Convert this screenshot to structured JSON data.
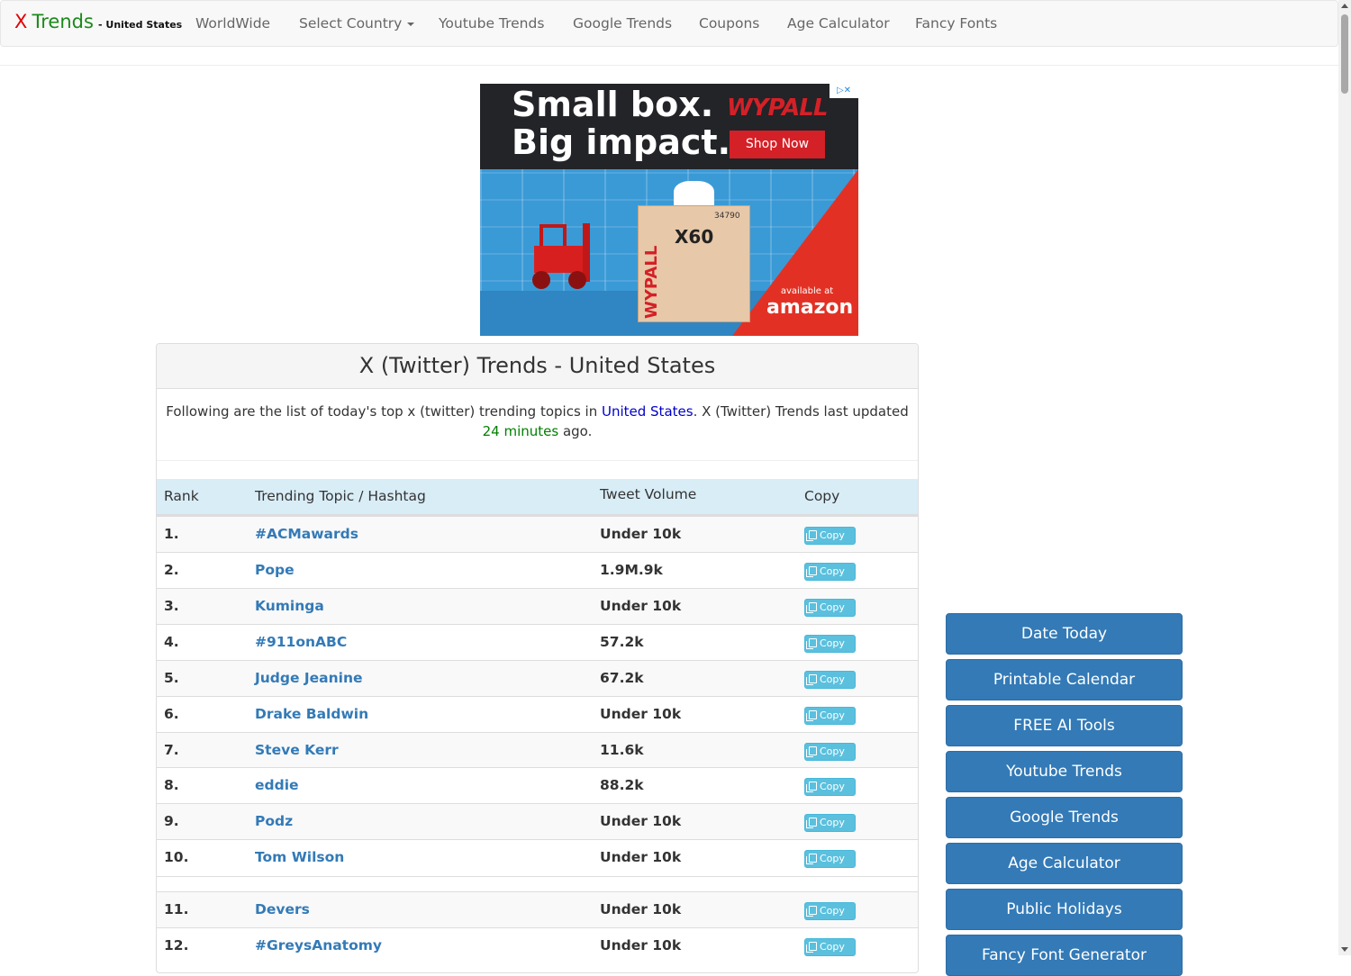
{
  "navbar": {
    "brand_x": "X",
    "brand_trends": "Trends",
    "brand_country": "- United States",
    "items": [
      {
        "label": "WorldWide"
      },
      {
        "label": "Select Country"
      },
      {
        "label": "Youtube Trends"
      },
      {
        "label": "Google Trends"
      },
      {
        "label": "Coupons"
      },
      {
        "label": "Age Calculator"
      },
      {
        "label": "Fancy Fonts"
      }
    ]
  },
  "ad": {
    "headline_1": "Small box.",
    "headline_2": "Big impact.",
    "brand": "WYPALL",
    "cta": "Shop Now",
    "product_label": "X60",
    "product_code": "34790",
    "available_at": "available at",
    "retailer": "amazon"
  },
  "panel": {
    "title": "X (Twitter) Trends - United States",
    "desc_prefix": "Following are the list of today's top x (twitter) trending topics in ",
    "desc_country": "United States",
    "desc_middle": ". X (Twitter) Trends last updated ",
    "desc_time": "24 minutes",
    "desc_suffix": " ago."
  },
  "table": {
    "headers": {
      "rank": "Rank",
      "topic": "Trending Topic / Hashtag",
      "volume": "Tweet Volume",
      "copy": "Copy"
    },
    "copy_label": "Copy",
    "rows": [
      {
        "rank": "1.",
        "topic": "#ACMawards",
        "volume": "Under 10k"
      },
      {
        "rank": "2.",
        "topic": "Pope",
        "volume": "1.9M.9k"
      },
      {
        "rank": "3.",
        "topic": "Kuminga",
        "volume": "Under 10k"
      },
      {
        "rank": "4.",
        "topic": "#911onABC",
        "volume": "57.2k"
      },
      {
        "rank": "5.",
        "topic": "Judge Jeanine",
        "volume": "67.2k"
      },
      {
        "rank": "6.",
        "topic": "Drake Baldwin",
        "volume": "Under 10k"
      },
      {
        "rank": "7.",
        "topic": "Steve Kerr",
        "volume": "11.6k"
      },
      {
        "rank": "8.",
        "topic": "eddie",
        "volume": "88.2k"
      },
      {
        "rank": "9.",
        "topic": "Podz",
        "volume": "Under 10k"
      },
      {
        "rank": "10.",
        "topic": "Tom Wilson",
        "volume": "Under 10k"
      },
      {
        "rank": "11.",
        "topic": "Devers",
        "volume": "Under 10k"
      },
      {
        "rank": "12.",
        "topic": "#GreysAnatomy",
        "volume": "Under 10k"
      }
    ]
  },
  "sidebar": {
    "buttons": [
      {
        "label": "Date Today"
      },
      {
        "label": "Printable Calendar"
      },
      {
        "label": "FREE AI Tools"
      },
      {
        "label": "Youtube Trends"
      },
      {
        "label": "Google Trends"
      },
      {
        "label": "Age Calculator"
      },
      {
        "label": "Public Holidays"
      },
      {
        "label": "Fancy Font Generator"
      }
    ]
  },
  "colors": {
    "brand_red": "#e00000",
    "brand_green": "#1a8a1a",
    "link": "#337ab7",
    "table_header_bg": "#d9edf7",
    "copy_button": "#5bc0de",
    "sidebar_button": "#337ab7"
  }
}
